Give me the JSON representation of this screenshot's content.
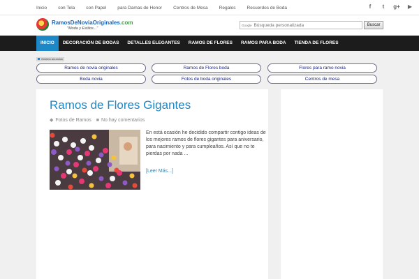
{
  "topnav": [
    "Inicio",
    "con Tela",
    "con Papel",
    "para Damas de Honor",
    "Centros de Mesa",
    "Regalos",
    "Recuerdos de Boda"
  ],
  "social": [
    {
      "name": "facebook-icon",
      "glyph": "f"
    },
    {
      "name": "twitter-icon",
      "glyph": "t"
    },
    {
      "name": "google-plus-icon",
      "glyph": "g+"
    },
    {
      "name": "youtube-icon",
      "glyph": "▶"
    }
  ],
  "logo": {
    "title_main": "RamosDeNoviaOriginales",
    "title_suffix": ".com",
    "tagline": "\"Moda y Estilos...\""
  },
  "search": {
    "brand": "Google",
    "placeholder": "Búsqueda personalizada",
    "button": "Buscar"
  },
  "mainnav": [
    "INICIO",
    "DECORACIÓN DE BODAS",
    "DETALLES ELEGANTES",
    "RAMOS DE FLORES",
    "RAMOS PARA BODA",
    "TIENDA DE FLORES"
  ],
  "ads": {
    "label": "Gestión anuncios",
    "links": [
      "Ramos de novia originales",
      "Ramos de Flores boda",
      "Flores para ramo novia",
      "Boda novia",
      "Fotos de boda originales",
      "Centros de mesa"
    ]
  },
  "post": {
    "title": "Ramos de Flores Gigantes",
    "category": "Fotos de Ramos",
    "comments": "No hay comentarios",
    "excerpt": "En está ocasión he decidido compartir contigo ideas de los mejores ramos de flores gigantes para aniversario, para nacimiento y para cumpleaños. Así que no te pierdas por nada ...",
    "read_more": "[Leer Más...]"
  },
  "colors": {
    "accent": "#1e88c7",
    "nav_bg": "#1c1c1c",
    "page_bg": "#f0f0f0"
  }
}
